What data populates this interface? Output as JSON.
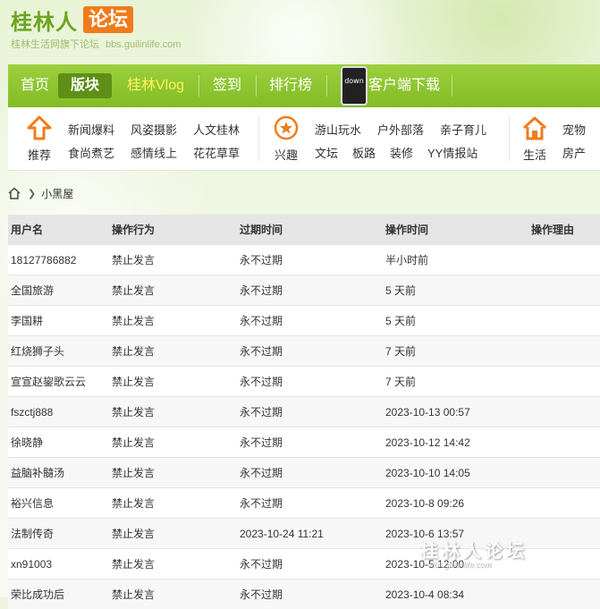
{
  "header": {
    "logo_main": "桂林人",
    "logo_box": "论坛",
    "tagline": "桂林生活网旗下论坛",
    "domain": "bbs.guilinlife.com"
  },
  "nav": {
    "items": [
      "首页",
      "版块",
      "桂林Vlog",
      "签到",
      "排行榜"
    ],
    "phone_label": "down",
    "download": "客户端下载"
  },
  "categories": {
    "groups": [
      {
        "label": "推荐",
        "icon": "up-arrow-icon",
        "links": [
          "新闻爆料",
          "风姿摄影",
          "人文桂林",
          "食尚煮艺",
          "感情线上",
          "花花草草"
        ]
      },
      {
        "label": "兴趣",
        "icon": "star-icon",
        "links": [
          "游山玩水",
          "户外部落",
          "亲子育儿",
          "文坛",
          "板路",
          "装修",
          "YY情报站"
        ]
      },
      {
        "label": "生活",
        "icon": "house-icon",
        "links": [
          "宠物",
          "房产"
        ]
      }
    ]
  },
  "breadcrumb": {
    "current": "小黑屋"
  },
  "table": {
    "headers": [
      "用户名",
      "操作行为",
      "过期时间",
      "操作时间",
      "操作理由"
    ],
    "rows": [
      [
        "18127786882",
        "禁止发言",
        "永不过期",
        "半小时前",
        ""
      ],
      [
        "全国旅游",
        "禁止发言",
        "永不过期",
        "5 天前",
        ""
      ],
      [
        "李国耕",
        "禁止发言",
        "永不过期",
        "5 天前",
        ""
      ],
      [
        "红烧狮子头",
        "禁止发言",
        "永不过期",
        "7 天前",
        ""
      ],
      [
        "宣宣赵鋆歌云云",
        "禁止发言",
        "永不过期",
        "7 天前",
        ""
      ],
      [
        "fszctj888",
        "禁止发言",
        "永不过期",
        "2023-10-13 00:57",
        ""
      ],
      [
        "徐晓静",
        "禁止发言",
        "永不过期",
        "2023-10-12 14:42",
        ""
      ],
      [
        "益脑补髓汤",
        "禁止发言",
        "永不过期",
        "2023-10-10 14:05",
        ""
      ],
      [
        "裕兴信息",
        "禁止发言",
        "永不过期",
        "2023-10-8 09:26",
        ""
      ],
      [
        "法制传奇",
        "禁止发言",
        "2023-10-24 11:21",
        "2023-10-6 13:57",
        ""
      ],
      [
        "xn91003",
        "禁止发言",
        "永不过期",
        "2023-10-5 12:00",
        ""
      ],
      [
        "荣比成功后",
        "禁止发言",
        "永不过期",
        "2023-10-4 08:34",
        ""
      ]
    ]
  },
  "watermark": {
    "main": "桂林人论坛",
    "sub": "bbs.guilinlife.com"
  },
  "colors": {
    "brand_green": "#82bc24",
    "brand_orange": "#f07b1a",
    "vlog_yellow": "#fff25c"
  }
}
